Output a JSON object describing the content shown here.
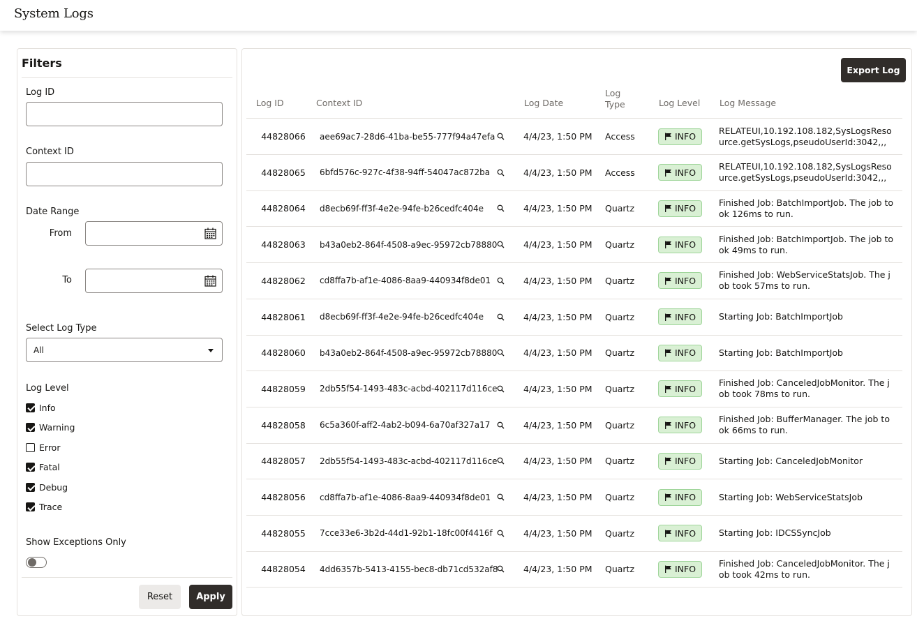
{
  "header": {
    "title": "System Logs"
  },
  "filters": {
    "title": "Filters",
    "log_id_label": "Log ID",
    "context_id_label": "Context ID",
    "date_range_label": "Date Range",
    "from_label": "From",
    "to_label": "To",
    "log_type_label": "Select Log Type",
    "log_type_value": "All",
    "log_level_label": "Log Level",
    "levels": [
      {
        "label": "Info",
        "checked": true
      },
      {
        "label": "Warning",
        "checked": true
      },
      {
        "label": "Error",
        "checked": false
      },
      {
        "label": "Fatal",
        "checked": true
      },
      {
        "label": "Debug",
        "checked": true
      },
      {
        "label": "Trace",
        "checked": true
      }
    ],
    "show_exceptions_label": "Show Exceptions Only",
    "show_exceptions_on": false,
    "reset_label": "Reset",
    "apply_label": "Apply"
  },
  "main": {
    "export_label": "Export Log",
    "columns": {
      "log_id": "Log ID",
      "context_id": "Context ID",
      "log_date": "Log Date",
      "log_type_1": "Log",
      "log_type_2": "Type",
      "log_level": "Log Level",
      "log_message": "Log Message"
    },
    "rows": [
      {
        "id": "44828066",
        "ctx": "aee69ac7-28d6-41ba-be55-777f94a47efa",
        "date": "4/4/23, 1:50 PM",
        "type": "Access",
        "level": "INFO",
        "msg": "RELATEUI,10.192.108.182,SysLogsResource.getSysLogs,pseudoUserId:3042,,,"
      },
      {
        "id": "44828065",
        "ctx": "6bfd576c-927c-4f38-94ff-54047ac872ba",
        "date": "4/4/23, 1:50 PM",
        "type": "Access",
        "level": "INFO",
        "msg": "RELATEUI,10.192.108.182,SysLogsResource.getSysLogs,pseudoUserId:3042,,,"
      },
      {
        "id": "44828064",
        "ctx": "d8ecb69f-ff3f-4e2e-94fe-b26cedfc404e",
        "date": "4/4/23, 1:50 PM",
        "type": "Quartz",
        "level": "INFO",
        "msg": "Finished Job: BatchImportJob. The job took 126ms to run."
      },
      {
        "id": "44828063",
        "ctx": "b43a0eb2-864f-4508-a9ec-95972cb78880",
        "date": "4/4/23, 1:50 PM",
        "type": "Quartz",
        "level": "INFO",
        "msg": "Finished Job: BatchImportJob. The job took 49ms to run."
      },
      {
        "id": "44828062",
        "ctx": "cd8ffa7b-af1e-4086-8aa9-440934f8de01",
        "date": "4/4/23, 1:50 PM",
        "type": "Quartz",
        "level": "INFO",
        "msg": "Finished Job: WebServiceStatsJob. The job took 57ms to run."
      },
      {
        "id": "44828061",
        "ctx": "d8ecb69f-ff3f-4e2e-94fe-b26cedfc404e",
        "date": "4/4/23, 1:50 PM",
        "type": "Quartz",
        "level": "INFO",
        "msg": "Starting Job: BatchImportJob"
      },
      {
        "id": "44828060",
        "ctx": "b43a0eb2-864f-4508-a9ec-95972cb78880",
        "date": "4/4/23, 1:50 PM",
        "type": "Quartz",
        "level": "INFO",
        "msg": "Starting Job: BatchImportJob"
      },
      {
        "id": "44828059",
        "ctx": "2db55f54-1493-483c-acbd-402117d116ce",
        "date": "4/4/23, 1:50 PM",
        "type": "Quartz",
        "level": "INFO",
        "msg": "Finished Job: CanceledJobMonitor. The job took 78ms to run."
      },
      {
        "id": "44828058",
        "ctx": "6c5a360f-aff2-4ab2-b094-6a70af327a17",
        "date": "4/4/23, 1:50 PM",
        "type": "Quartz",
        "level": "INFO",
        "msg": "Finished Job: BufferManager. The job took 66ms to run."
      },
      {
        "id": "44828057",
        "ctx": "2db55f54-1493-483c-acbd-402117d116ce",
        "date": "4/4/23, 1:50 PM",
        "type": "Quartz",
        "level": "INFO",
        "msg": "Starting Job: CanceledJobMonitor"
      },
      {
        "id": "44828056",
        "ctx": "cd8ffa7b-af1e-4086-8aa9-440934f8de01",
        "date": "4/4/23, 1:50 PM",
        "type": "Quartz",
        "level": "INFO",
        "msg": "Starting Job: WebServiceStatsJob"
      },
      {
        "id": "44828055",
        "ctx": "7cce33e6-3b2d-44d1-92b1-18fc00f4416f",
        "date": "4/4/23, 1:50 PM",
        "type": "Quartz",
        "level": "INFO",
        "msg": "Starting Job: IDCSSyncJob"
      },
      {
        "id": "44828054",
        "ctx": "4dd6357b-5413-4155-bec8-db71cd532af8",
        "date": "4/4/23, 1:50 PM",
        "type": "Quartz",
        "level": "INFO",
        "msg": "Finished Job: CanceledJobMonitor. The job took 42ms to run."
      }
    ]
  },
  "colors": {
    "primary_button": "#312d2a",
    "info_badge_bg": "#d9f0d4",
    "info_badge_border": "#9fd59a",
    "muted_text": "#6f6b67"
  },
  "icons": {
    "calendar": "calendar-icon",
    "search": "search-icon",
    "flag": "flag-icon",
    "dropdown": "chevron-down-icon"
  }
}
